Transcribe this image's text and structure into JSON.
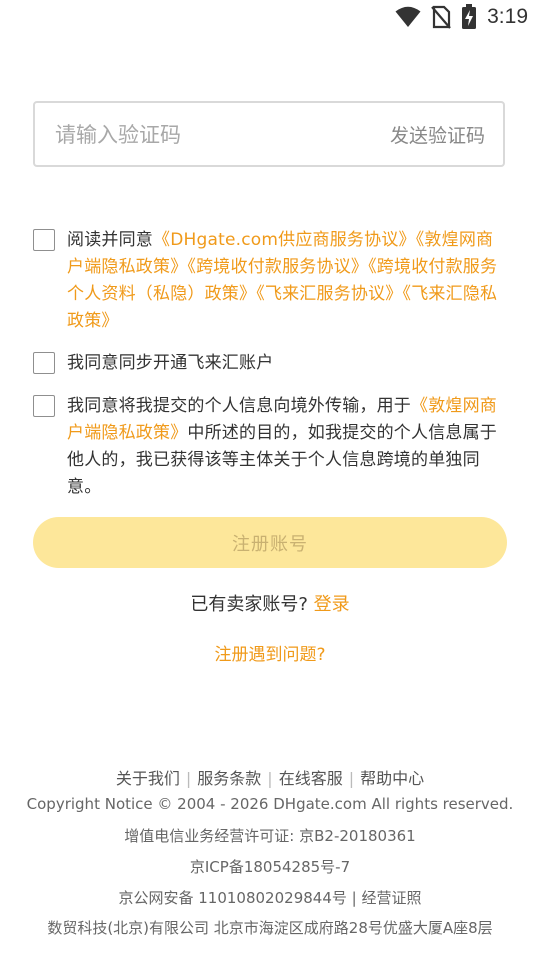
{
  "status_bar": {
    "time": "3:19",
    "icons": [
      "wifi-icon",
      "no-sim-icon",
      "battery-charging-icon"
    ]
  },
  "verification": {
    "placeholder": "请输入验证码",
    "value": "",
    "send_code_label": "发送验证码"
  },
  "agreement_1": {
    "prefix": "阅读并同意",
    "links": [
      "《DHgate.com供应商服务协议》",
      "《敦煌网商户端隐私政策》",
      "《跨境收付款服务协议》",
      "《跨境收付款服务个人资料（私隐）政策》",
      "《飞来汇服务协议》",
      "《飞来汇隐私政策》"
    ]
  },
  "agreement_2": {
    "text": "我同意同步开通飞来汇账户"
  },
  "agreement_3": {
    "prefix": "我同意将我提交的个人信息向境外传输，用于",
    "link": "《敦煌网商户端隐私政策》",
    "suffix": "中所述的目的，如我提交的个人信息属于他人的，我已获得该等主体关于个人信息跨境的单独同意。"
  },
  "register_button": "注册账号",
  "login_prompt": {
    "text": "已有卖家账号?",
    "link": "登录"
  },
  "problem_link": "注册遇到问题?",
  "footer": {
    "links": [
      "关于我们",
      "服务条款",
      "在线客服",
      "帮助中心"
    ],
    "separator": "|",
    "copyright": "Copyright Notice © 2004 - 2026 DHgate.com All rights reserved.",
    "license": "增值电信业务经营许可证: 京B2-20180361",
    "icp": "京ICP备18054285号-7",
    "police": "京公网安备 11010802029844号",
    "police_sep": "|",
    "business_license": "经营证照",
    "company": "数贸科技(北京)有限公司 北京市海淀区成府路28号优盛大厦A座8层"
  },
  "colors": {
    "accent": "#f09a1a",
    "button_bg": "#fde79a",
    "button_text": "#c9b171"
  }
}
